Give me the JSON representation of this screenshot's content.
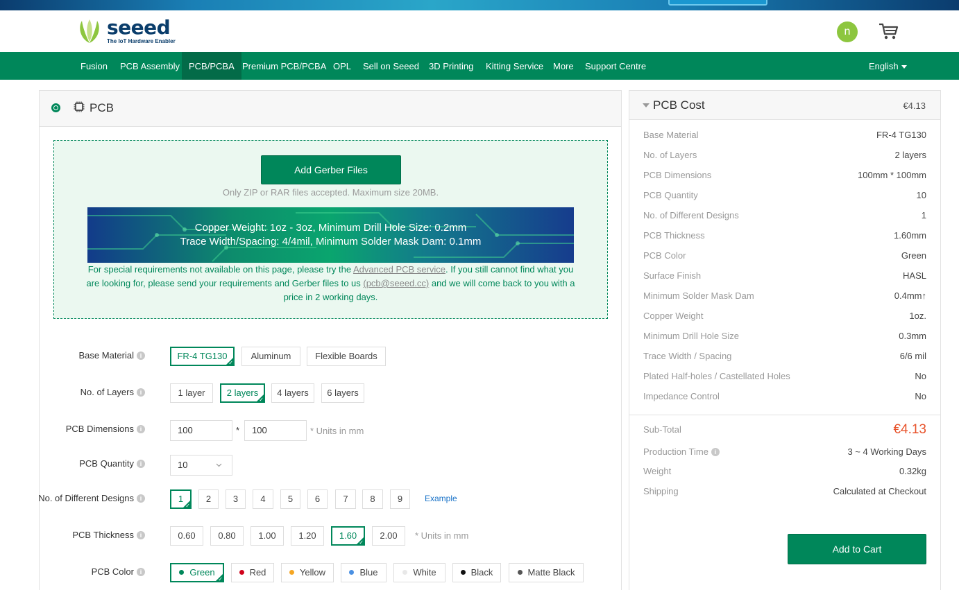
{
  "header": {
    "logo_word": "seeed",
    "logo_tag": "The IoT Hardware Enabler",
    "avatar_initial": "n"
  },
  "nav": {
    "items": [
      "Fusion",
      "PCB Assembly",
      "PCB/PCBA",
      "Premium PCB/PCBA",
      "OPL",
      "Sell on Seeed",
      "3D Printing",
      "Kitting Service",
      "More",
      "Support Centre"
    ],
    "active": "PCB/PCBA",
    "language": "English"
  },
  "main": {
    "title": "PCB",
    "upload_button": "Add Gerber Files",
    "upload_note": "Only ZIP or RAR files accepted. Maximum size 20MB.",
    "banner_line1": "Copper Weight: 1oz - 3oz, Minimum Drill Hole Size: 0.2mm",
    "banner_line2": "Trace Width/Spacing: 4/4mil, Minimum Solder Mask Dam: 0.1mm",
    "help_pre": "For special requirements not available on this page, please try the ",
    "help_link": "Advanced PCB service",
    "help_mid": ". If you still cannot find what you are looking for, please send your requirements and Gerber files to us ",
    "help_email": "(pcb@seeed.cc)",
    "help_post": " and we will come back to you with a price in 2 working days."
  },
  "form": {
    "base_material": {
      "label": "Base Material",
      "options": [
        "FR-4 TG130",
        "Aluminum",
        "Flexible Boards"
      ],
      "selected": "FR-4 TG130"
    },
    "layers": {
      "label": "No. of Layers",
      "options": [
        "1 layer",
        "2 layers",
        "4 layers",
        "6 layers"
      ],
      "selected": "2 layers"
    },
    "dimensions": {
      "label": "PCB Dimensions",
      "width": "100",
      "height": "100",
      "separator": "*",
      "hint": "* Units in mm"
    },
    "quantity": {
      "label": "PCB Quantity",
      "value": "10"
    },
    "designs": {
      "label": "No. of Different Designs",
      "options": [
        "1",
        "2",
        "3",
        "4",
        "5",
        "6",
        "7",
        "8",
        "9"
      ],
      "selected": "1",
      "example": "Example"
    },
    "thickness": {
      "label": "PCB Thickness",
      "options": [
        "0.60",
        "0.80",
        "1.00",
        "1.20",
        "1.60",
        "2.00"
      ],
      "selected": "1.60",
      "hint": "* Units in mm"
    },
    "color": {
      "label": "PCB Color",
      "options": [
        {
          "name": "Green",
          "color": "#00875a"
        },
        {
          "name": "Red",
          "color": "#d0021b"
        },
        {
          "name": "Yellow",
          "color": "#f5a623"
        },
        {
          "name": "Blue",
          "color": "#4a90e2"
        },
        {
          "name": "White",
          "color": "#e8e8e8"
        },
        {
          "name": "Black",
          "color": "#111111"
        },
        {
          "name": "Matte Black",
          "color": "#555555"
        }
      ],
      "selected": "Green"
    }
  },
  "cost": {
    "title": "PCB Cost",
    "total": "€4.13",
    "specs": [
      {
        "k": "Base Material",
        "v": "FR-4 TG130"
      },
      {
        "k": "No. of Layers",
        "v": "2 layers"
      },
      {
        "k": "PCB Dimensions",
        "v": "100mm * 100mm"
      },
      {
        "k": "PCB Quantity",
        "v": "10"
      },
      {
        "k": "No. of Different Designs",
        "v": "1"
      },
      {
        "k": "PCB Thickness",
        "v": "1.60mm"
      },
      {
        "k": "PCB Color",
        "v": "Green"
      },
      {
        "k": "Surface Finish",
        "v": "HASL"
      },
      {
        "k": "Minimum Solder Mask Dam",
        "v": "0.4mm↑"
      },
      {
        "k": "Copper Weight",
        "v": "1oz."
      },
      {
        "k": "Minimum Drill Hole Size",
        "v": "0.3mm"
      },
      {
        "k": "Trace Width / Spacing",
        "v": "6/6 mil"
      },
      {
        "k": "Plated Half-holes / Castellated Holes",
        "v": "No"
      },
      {
        "k": "Impedance Control",
        "v": "No"
      }
    ],
    "subtotal_label": "Sub-Total",
    "subtotal": "€4.13",
    "production_label": "Production Time",
    "production": "3 ~ 4 Working Days",
    "weight_label": "Weight",
    "weight": "0.32kg",
    "shipping_label": "Shipping",
    "shipping": "Calculated at Checkout",
    "add_to_cart": "Add to Cart"
  },
  "colors": {
    "brand_green": "#00875a",
    "nav_active": "#036b48",
    "price_red": "#e8532b"
  }
}
